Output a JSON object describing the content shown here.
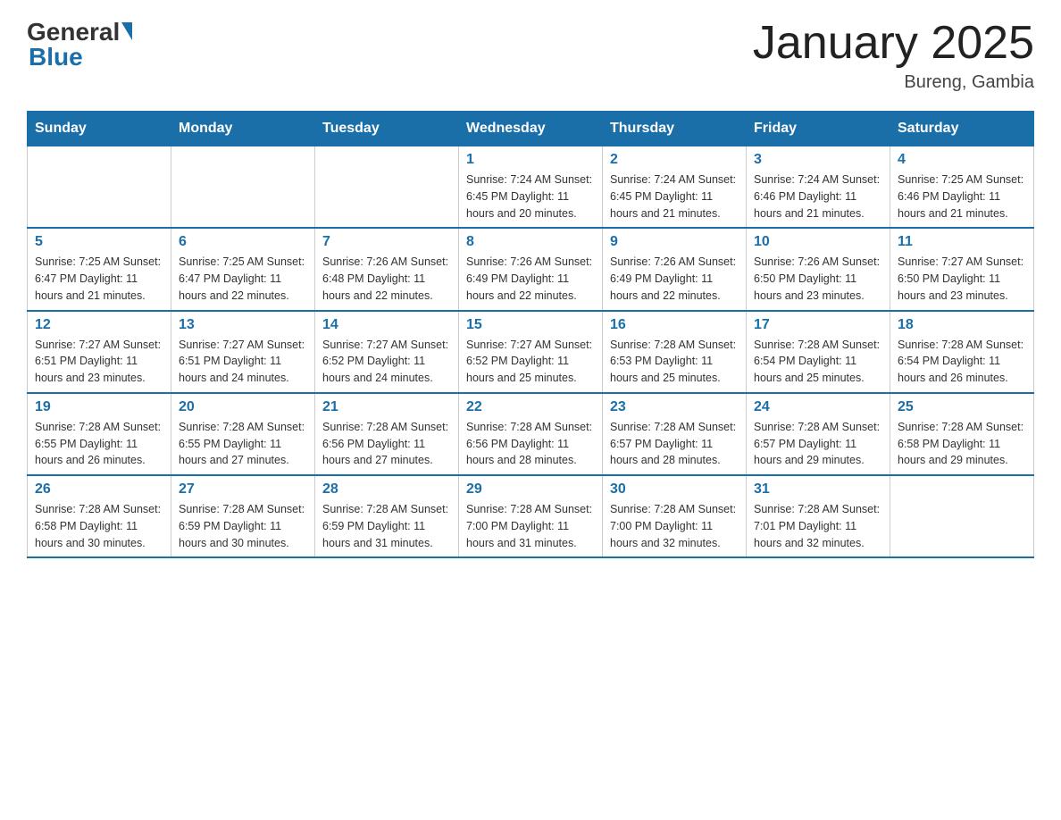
{
  "logo": {
    "general": "General",
    "blue": "Blue"
  },
  "title": "January 2025",
  "subtitle": "Bureng, Gambia",
  "days_header": [
    "Sunday",
    "Monday",
    "Tuesday",
    "Wednesday",
    "Thursday",
    "Friday",
    "Saturday"
  ],
  "weeks": [
    [
      {
        "num": "",
        "info": ""
      },
      {
        "num": "",
        "info": ""
      },
      {
        "num": "",
        "info": ""
      },
      {
        "num": "1",
        "info": "Sunrise: 7:24 AM\nSunset: 6:45 PM\nDaylight: 11 hours and 20 minutes."
      },
      {
        "num": "2",
        "info": "Sunrise: 7:24 AM\nSunset: 6:45 PM\nDaylight: 11 hours and 21 minutes."
      },
      {
        "num": "3",
        "info": "Sunrise: 7:24 AM\nSunset: 6:46 PM\nDaylight: 11 hours and 21 minutes."
      },
      {
        "num": "4",
        "info": "Sunrise: 7:25 AM\nSunset: 6:46 PM\nDaylight: 11 hours and 21 minutes."
      }
    ],
    [
      {
        "num": "5",
        "info": "Sunrise: 7:25 AM\nSunset: 6:47 PM\nDaylight: 11 hours and 21 minutes."
      },
      {
        "num": "6",
        "info": "Sunrise: 7:25 AM\nSunset: 6:47 PM\nDaylight: 11 hours and 22 minutes."
      },
      {
        "num": "7",
        "info": "Sunrise: 7:26 AM\nSunset: 6:48 PM\nDaylight: 11 hours and 22 minutes."
      },
      {
        "num": "8",
        "info": "Sunrise: 7:26 AM\nSunset: 6:49 PM\nDaylight: 11 hours and 22 minutes."
      },
      {
        "num": "9",
        "info": "Sunrise: 7:26 AM\nSunset: 6:49 PM\nDaylight: 11 hours and 22 minutes."
      },
      {
        "num": "10",
        "info": "Sunrise: 7:26 AM\nSunset: 6:50 PM\nDaylight: 11 hours and 23 minutes."
      },
      {
        "num": "11",
        "info": "Sunrise: 7:27 AM\nSunset: 6:50 PM\nDaylight: 11 hours and 23 minutes."
      }
    ],
    [
      {
        "num": "12",
        "info": "Sunrise: 7:27 AM\nSunset: 6:51 PM\nDaylight: 11 hours and 23 minutes."
      },
      {
        "num": "13",
        "info": "Sunrise: 7:27 AM\nSunset: 6:51 PM\nDaylight: 11 hours and 24 minutes."
      },
      {
        "num": "14",
        "info": "Sunrise: 7:27 AM\nSunset: 6:52 PM\nDaylight: 11 hours and 24 minutes."
      },
      {
        "num": "15",
        "info": "Sunrise: 7:27 AM\nSunset: 6:52 PM\nDaylight: 11 hours and 25 minutes."
      },
      {
        "num": "16",
        "info": "Sunrise: 7:28 AM\nSunset: 6:53 PM\nDaylight: 11 hours and 25 minutes."
      },
      {
        "num": "17",
        "info": "Sunrise: 7:28 AM\nSunset: 6:54 PM\nDaylight: 11 hours and 25 minutes."
      },
      {
        "num": "18",
        "info": "Sunrise: 7:28 AM\nSunset: 6:54 PM\nDaylight: 11 hours and 26 minutes."
      }
    ],
    [
      {
        "num": "19",
        "info": "Sunrise: 7:28 AM\nSunset: 6:55 PM\nDaylight: 11 hours and 26 minutes."
      },
      {
        "num": "20",
        "info": "Sunrise: 7:28 AM\nSunset: 6:55 PM\nDaylight: 11 hours and 27 minutes."
      },
      {
        "num": "21",
        "info": "Sunrise: 7:28 AM\nSunset: 6:56 PM\nDaylight: 11 hours and 27 minutes."
      },
      {
        "num": "22",
        "info": "Sunrise: 7:28 AM\nSunset: 6:56 PM\nDaylight: 11 hours and 28 minutes."
      },
      {
        "num": "23",
        "info": "Sunrise: 7:28 AM\nSunset: 6:57 PM\nDaylight: 11 hours and 28 minutes."
      },
      {
        "num": "24",
        "info": "Sunrise: 7:28 AM\nSunset: 6:57 PM\nDaylight: 11 hours and 29 minutes."
      },
      {
        "num": "25",
        "info": "Sunrise: 7:28 AM\nSunset: 6:58 PM\nDaylight: 11 hours and 29 minutes."
      }
    ],
    [
      {
        "num": "26",
        "info": "Sunrise: 7:28 AM\nSunset: 6:58 PM\nDaylight: 11 hours and 30 minutes."
      },
      {
        "num": "27",
        "info": "Sunrise: 7:28 AM\nSunset: 6:59 PM\nDaylight: 11 hours and 30 minutes."
      },
      {
        "num": "28",
        "info": "Sunrise: 7:28 AM\nSunset: 6:59 PM\nDaylight: 11 hours and 31 minutes."
      },
      {
        "num": "29",
        "info": "Sunrise: 7:28 AM\nSunset: 7:00 PM\nDaylight: 11 hours and 31 minutes."
      },
      {
        "num": "30",
        "info": "Sunrise: 7:28 AM\nSunset: 7:00 PM\nDaylight: 11 hours and 32 minutes."
      },
      {
        "num": "31",
        "info": "Sunrise: 7:28 AM\nSunset: 7:01 PM\nDaylight: 11 hours and 32 minutes."
      },
      {
        "num": "",
        "info": ""
      }
    ]
  ]
}
